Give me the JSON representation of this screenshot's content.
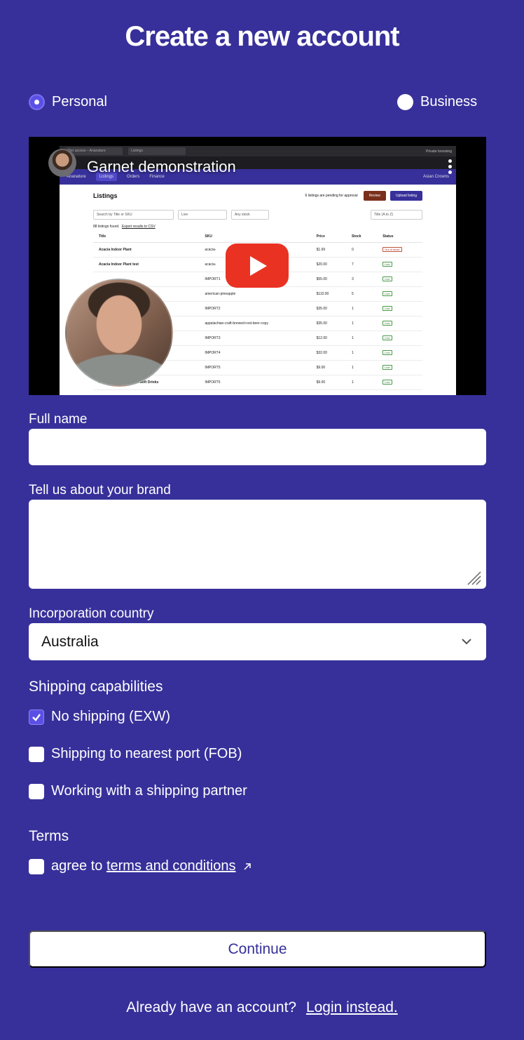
{
  "page": {
    "title": "Create a new account"
  },
  "account_type": {
    "options": [
      {
        "label": "Personal",
        "selected": true
      },
      {
        "label": "Business",
        "selected": false
      }
    ]
  },
  "video": {
    "title": "Garnet demonstration",
    "screen": {
      "tabs": [
        "Tier access – Ananature",
        "Listings"
      ],
      "browser_badge": "Private browsing",
      "brand": "Ananature",
      "nav": [
        "Listings",
        "Orders",
        "Finance"
      ],
      "account": "Asian Crowns",
      "heading": "Listings",
      "pending_text": "6 listings are pending for approval",
      "review_label": "Review",
      "upload_label": "Upload listing",
      "search_placeholder": "Search by Title or SKU",
      "filter_status": "Live",
      "filter_stock": "Any stock",
      "sort": "Title (A to Z)",
      "found_text": "88 listings found.",
      "export_text": "Export results to CSV",
      "columns": [
        "Title",
        "SKU",
        "Price",
        "Stock",
        "Status"
      ],
      "rows": [
        [
          "Acacia Indoor Plant",
          "acacia-",
          "$1.69",
          "0",
          "Out of stock"
        ],
        [
          "Acacia Indoor Plant test",
          "acacia-",
          "$20.00",
          "7",
          "Live"
        ],
        [
          "",
          "IMPORT1",
          "$55.00",
          "3",
          "Live"
        ],
        [
          "",
          "american-pineapple",
          "$110.00",
          "5",
          "Live"
        ],
        [
          "",
          "IMPORT2",
          "$35.00",
          "1",
          "Live"
        ],
        [
          "opy",
          "appalachian-craft-brewed-root-beer-copy",
          "$35.00",
          "1",
          "Live"
        ],
        [
          "",
          "IMPORT3",
          "$12.00",
          "1",
          "Live"
        ],
        [
          "",
          "IMPORT4",
          "$32.00",
          "1",
          "Live"
        ],
        [
          "Drinks",
          "IMPORT5",
          "$9.00",
          "1",
          "Live"
        ],
        [
          "Aroha Sparkling Natural Soft Drinks",
          "IMPORT5",
          "$9.00",
          "1",
          "Live"
        ]
      ]
    }
  },
  "form": {
    "full_name_label": "Full name",
    "full_name_value": "",
    "brand_label": "Tell us about your brand",
    "brand_value": "",
    "country_label": "Incorporation country",
    "country_value": "Australia",
    "shipping_heading": "Shipping capabilities",
    "shipping_options": [
      {
        "label": "No shipping (EXW)",
        "checked": true
      },
      {
        "label": "Shipping to nearest port (FOB)",
        "checked": false
      },
      {
        "label": "Working with a shipping partner",
        "checked": false
      }
    ],
    "terms_heading": "Terms",
    "terms_prefix": "agree to",
    "terms_link": "terms and conditions",
    "terms_checked": false
  },
  "actions": {
    "continue_label": "Continue",
    "login_prompt": "Already have an account?",
    "login_link": "Login instead."
  },
  "colors": {
    "background": "#37309a",
    "accent": "#5b50e6",
    "play_button": "#ea3223"
  }
}
